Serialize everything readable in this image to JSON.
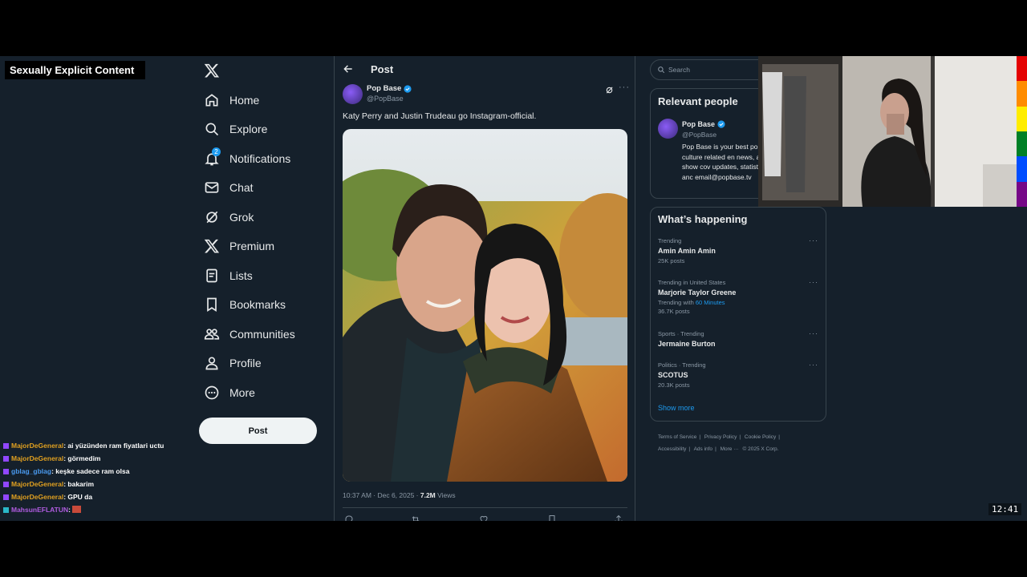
{
  "overlay": {
    "content_warning": "Sexually Explicit Content",
    "chat": [
      {
        "user": "MajorDeGeneral",
        "color": "#e0a020",
        "message": "ai yüzünden ram fiyatlari uctu"
      },
      {
        "user": "MajorDeGeneral",
        "color": "#e0a020",
        "message": "görmedim"
      },
      {
        "user": "gblag_gblag",
        "color": "#4a9aef",
        "message": "keşke sadece ram olsa"
      },
      {
        "user": "MajorDeGeneral",
        "color": "#e0a020",
        "message": "bakarim"
      },
      {
        "user": "MajorDeGeneral",
        "color": "#e0a020",
        "message": "GPU da"
      },
      {
        "user": "MahsunEFLATUN",
        "color": "#b05ce0",
        "message": ""
      }
    ],
    "clock": "12:41"
  },
  "nav": {
    "items": [
      {
        "label": "Home",
        "icon": "home-icon"
      },
      {
        "label": "Explore",
        "icon": "search-icon"
      },
      {
        "label": "Notifications",
        "icon": "bell-icon",
        "badge": "2"
      },
      {
        "label": "Chat",
        "icon": "mail-icon"
      },
      {
        "label": "Grok",
        "icon": "grok-icon"
      },
      {
        "label": "Premium",
        "icon": "x-logo-icon"
      },
      {
        "label": "Lists",
        "icon": "list-icon"
      },
      {
        "label": "Bookmarks",
        "icon": "bookmark-icon"
      },
      {
        "label": "Communities",
        "icon": "communities-icon"
      },
      {
        "label": "Profile",
        "icon": "person-icon"
      },
      {
        "label": "More",
        "icon": "more-circle-icon"
      }
    ],
    "post_button": "Post"
  },
  "main": {
    "title": "Post",
    "author": {
      "name": "Pop Base",
      "handle": "@PopBase"
    },
    "text": "Katy Perry and Justin Trudeau go Instagram-official.",
    "time": "10:37 AM · Dec 6, 2025 · ",
    "views_count": "7.2M",
    "views_label": " Views"
  },
  "right": {
    "search_placeholder": "Search",
    "relevant_title": "Relevant people",
    "relevant": {
      "name": "Pop Base",
      "handle": "@PopBase",
      "bio": "Pop Base is your best pop culture related en news, award show cov updates, statistics anc email@popbase.tv"
    },
    "happening_title": "What’s happening",
    "trends": [
      {
        "category": "Trending",
        "name": "Amin Amin Amin",
        "count": "25K posts"
      },
      {
        "category": "Trending in United States",
        "name": "Marjorie Taylor Greene",
        "count_prefix": "Trending with ",
        "count_highlight": "60 Minutes",
        "count": "36.7K posts"
      },
      {
        "category": "Sports · Trending",
        "name": "Jermaine Burton",
        "count": ""
      },
      {
        "category": "Politics · Trending",
        "name": "SCOTUS",
        "count": "20.3K posts"
      }
    ],
    "show_more": "Show more",
    "footer": {
      "line1": [
        "Terms of Service",
        "|",
        "Privacy Policy",
        "|",
        "Cookie Policy",
        "|"
      ],
      "line2": [
        "Accessibility",
        "|",
        "Ads info",
        "|",
        "More ···",
        "© 2025 X Corp."
      ]
    }
  },
  "colors": {
    "background": "#15202b",
    "border": "#38444d",
    "accent": "#1d9bf0",
    "muted": "#8b98a5"
  }
}
